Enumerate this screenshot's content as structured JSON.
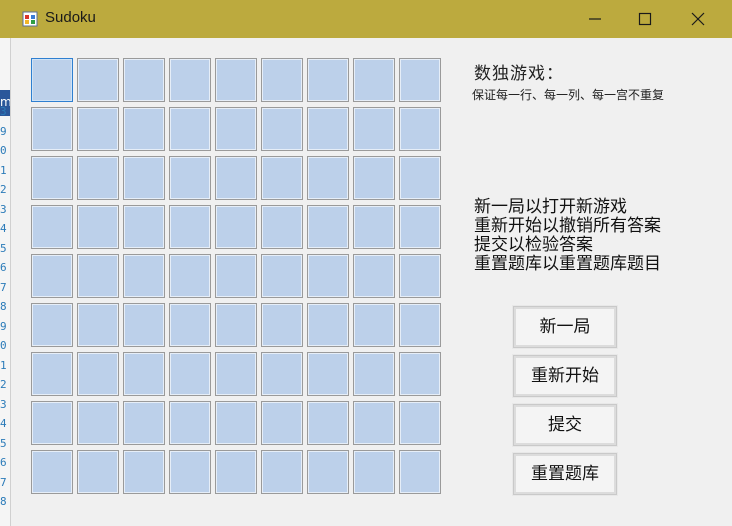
{
  "window": {
    "title": "Sudoku"
  },
  "background_editor": {
    "menu_fragment": "m",
    "line_digits": [
      "3",
      "9",
      "0",
      "1",
      "2",
      "3",
      "4",
      "5",
      "6",
      "7",
      "8",
      "9",
      "0",
      "1",
      "2",
      "3",
      "4",
      "5",
      "6",
      "7",
      "8"
    ]
  },
  "board": {
    "rows": 9,
    "cols": 9,
    "focused_cell": [
      0,
      0
    ],
    "cell_values": [
      [
        "",
        "",
        "",
        "",
        "",
        "",
        "",
        "",
        ""
      ],
      [
        "",
        "",
        "",
        "",
        "",
        "",
        "",
        "",
        ""
      ],
      [
        "",
        "",
        "",
        "",
        "",
        "",
        "",
        "",
        ""
      ],
      [
        "",
        "",
        "",
        "",
        "",
        "",
        "",
        "",
        ""
      ],
      [
        "",
        "",
        "",
        "",
        "",
        "",
        "",
        "",
        ""
      ],
      [
        "",
        "",
        "",
        "",
        "",
        "",
        "",
        "",
        ""
      ],
      [
        "",
        "",
        "",
        "",
        "",
        "",
        "",
        "",
        ""
      ],
      [
        "",
        "",
        "",
        "",
        "",
        "",
        "",
        "",
        ""
      ],
      [
        "",
        "",
        "",
        "",
        "",
        "",
        "",
        "",
        ""
      ]
    ]
  },
  "info": {
    "heading": "数独游戏：",
    "rule": "保证每一行、每一列、每一宫不重复",
    "instructions": [
      "新一局以打开新游戏",
      "重新开始以撤销所有答案",
      "提交以检验答案",
      "重置题库以重置题库题目"
    ]
  },
  "buttons": {
    "new_game": "新一局",
    "restart": "重新开始",
    "submit": "提交",
    "reset_bank": "重置题库"
  },
  "colors": {
    "titlebar": "#bcaa3e",
    "cell_fill": "#bcd0ea",
    "cell_focus_border": "#2f7fd0"
  }
}
